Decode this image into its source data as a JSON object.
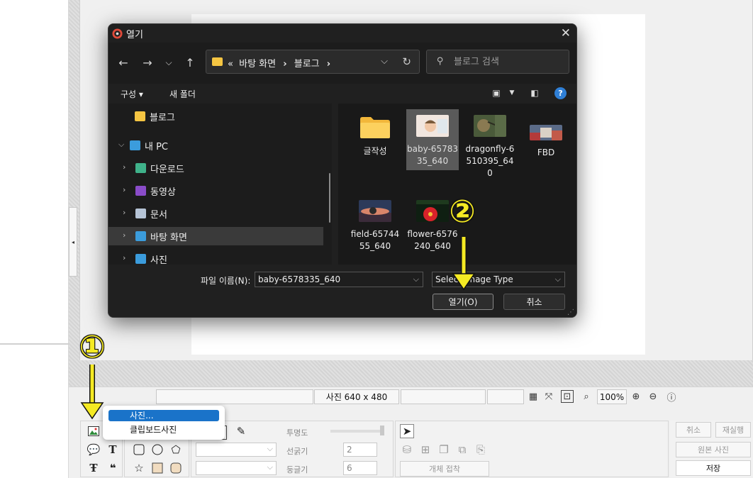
{
  "dialog": {
    "title": "열기",
    "address": {
      "prefix": "«",
      "crumb1": "바탕 화면",
      "sep1": "›",
      "crumb2": "블로그",
      "sep2": "›"
    },
    "search": {
      "placeholder": "블로그 검색"
    },
    "commands": {
      "organize": "구성 ▾",
      "new_folder": "새 폴더"
    },
    "tree": [
      {
        "label": "블로그",
        "icon": "folder-icon",
        "color": "#f5c542"
      },
      {
        "label": "내 PC",
        "icon": "pc-icon",
        "color": "#3b9cdc"
      },
      {
        "label": "다운로드",
        "icon": "download-icon",
        "color": "#3fb28a"
      },
      {
        "label": "동영상",
        "icon": "video-icon",
        "color": "#8a4cc9"
      },
      {
        "label": "문서",
        "icon": "document-icon",
        "color": "#b6c4d6"
      },
      {
        "label": "바탕 화면",
        "icon": "desktop-icon",
        "color": "#3b9cdc"
      },
      {
        "label": "사진",
        "icon": "pictures-icon",
        "color": "#3b9cdc"
      }
    ],
    "files": [
      {
        "label": "글작성",
        "kind": "folder"
      },
      {
        "label": "baby-6578335_640",
        "kind": "image"
      },
      {
        "label": "dragonfly-6510395_640",
        "kind": "image"
      },
      {
        "label": "FBD",
        "kind": "image"
      },
      {
        "label": "field-6574455_640",
        "kind": "image"
      },
      {
        "label": "flower-6576240_640",
        "kind": "image"
      }
    ],
    "filename_label": "파일 이름(N):",
    "filename_value": "baby-6578335_640",
    "file_type": "Select Image Type",
    "open_button": "열기(O)",
    "cancel_button": "취소"
  },
  "status_bar": {
    "image_size": "사진 640 x 480",
    "zoom": "100%"
  },
  "toolbar": {
    "opacity_label": "투명도",
    "line_label": "선굵기",
    "line_value": "2",
    "round_label": "둥글기",
    "round_value": "6",
    "object_attach": "개체 접착",
    "cancel": "취소",
    "redo": "재실행",
    "original_photo": "원본 사진",
    "save": "저장"
  },
  "context_menu": {
    "items": [
      "사진...",
      "클립보드사진"
    ]
  },
  "annotations": {
    "step1": "①",
    "step2": "②",
    "color": "#f5ea23"
  }
}
